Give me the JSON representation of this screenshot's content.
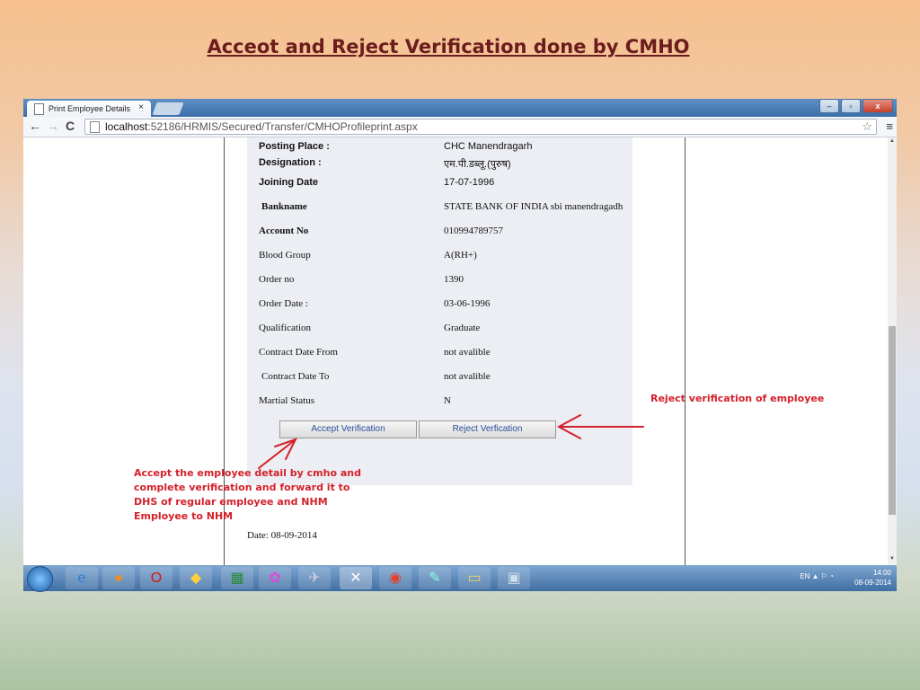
{
  "slide": {
    "title": "Acceot and Reject Verification done by CMHO"
  },
  "browser": {
    "tab_title": "Print Employee Details",
    "tab_close": "×",
    "url_host": "localhost",
    "url_path": ":52186/HRMIS/Secured/Transfer/CMHOProfileprint.aspx"
  },
  "form": {
    "rows": [
      {
        "label": "Posting Place :",
        "value": "CHC Manendragarh"
      },
      {
        "label": "Designation :",
        "value": "एम.पी.डब्लू.(पुरुष)"
      },
      {
        "label": "Joining Date",
        "value": "17-07-1996"
      },
      {
        "label": "Bankname",
        "value": "STATE BANK OF INDIA sbi manendragadh"
      },
      {
        "label": "Account No",
        "value": "010994789757"
      },
      {
        "label": "Blood Group",
        "value": "A(RH+)"
      },
      {
        "label": "Order no",
        "value": "1390"
      },
      {
        "label": "Order Date :",
        "value": "03-06-1996"
      },
      {
        "label": "Qualification",
        "value": "Graduate"
      },
      {
        "label": "Contract Date From",
        "value": "not avalible"
      },
      {
        "label": "Contract Date To",
        "value": "not avalible"
      },
      {
        "label": "Martial Status",
        "value": "N"
      }
    ],
    "accept_label": "Accept Verification",
    "reject_label": "Reject Verfication",
    "date_text": "Date: 08-09-2014"
  },
  "annotations": {
    "reject": "Reject verification of employee",
    "accept": "Accept the employee detail by cmho and complete verification and forward it to DHS of regular employee and NHM Employee to NHM"
  },
  "taskbar": {
    "lang": "EN",
    "time": "14:00",
    "date": "08-09-2014"
  },
  "colors": {
    "annotation": "#d4202a",
    "title": "#6b1d1d"
  }
}
